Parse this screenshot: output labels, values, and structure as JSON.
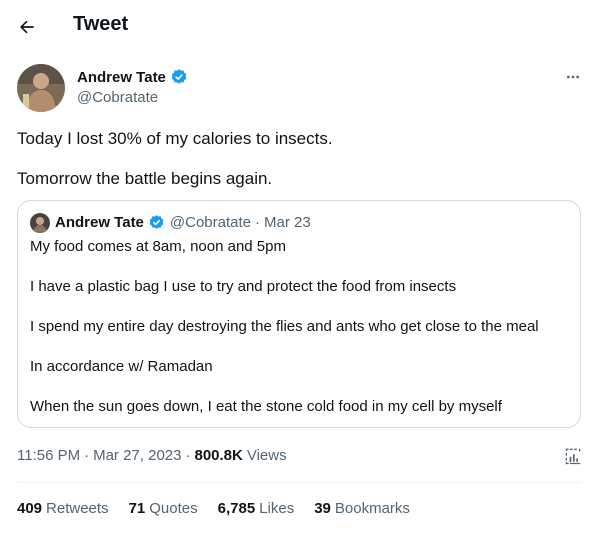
{
  "header": {
    "title": "Tweet"
  },
  "author": {
    "name": "Andrew Tate",
    "handle": "@Cobratate"
  },
  "tweet": {
    "lines": [
      "Today I lost 30% of my calories to insects.",
      "Tomorrow the battle begins again."
    ]
  },
  "quote": {
    "name": "Andrew Tate",
    "handle": "@Cobratate",
    "dot": "·",
    "date": "Mar 23",
    "lines": [
      "My food comes at 8am, noon and 5pm",
      "I have a plastic bag I use to try and protect the food from insects",
      "I spend my entire day destroying the flies and ants who get close to the meal",
      "In accordance w/ Ramadan",
      "When the sun goes down, I eat the stone cold food in my cell by myself"
    ]
  },
  "meta": {
    "time": "11:56 PM",
    "dot1": "·",
    "date": "Mar 27, 2023",
    "dot2": "·",
    "views_count": "800.8K",
    "views_label": "Views"
  },
  "stats": [
    {
      "count": "409",
      "label": "Retweets"
    },
    {
      "count": "71",
      "label": "Quotes"
    },
    {
      "count": "6,785",
      "label": "Likes"
    },
    {
      "count": "39",
      "label": "Bookmarks"
    }
  ],
  "icons": {
    "back": "arrow-left-icon",
    "verified": "verified-badge-icon",
    "more": "more-horizontal-icon",
    "analytics": "analytics-icon"
  },
  "colors": {
    "verified": "#1d9bf0",
    "secondary_text": "#536471",
    "border": "#cfd9de"
  }
}
